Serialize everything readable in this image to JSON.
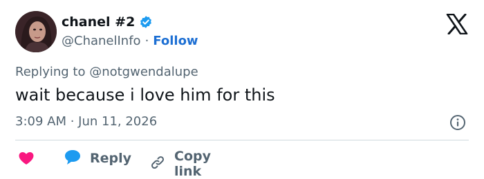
{
  "author": {
    "display_name": "chanel #2",
    "handle": "@ChanelInfo",
    "separator": "·",
    "follow_label": "Follow",
    "verified_color": "#1d9bf0"
  },
  "tweet": {
    "replying_to": "Replying to @notgwendalupe",
    "text": "wait because i love him for this",
    "timestamp": "3:09 AM · Jun 11, 2026"
  },
  "actions": {
    "reply_label": "Reply",
    "copy_link_label": "Copy link",
    "heart_color": "#f91880",
    "reply_icon_color": "#1d9bf0"
  },
  "icons": {
    "logo": "x-logo-icon",
    "info": "info-icon",
    "like": "heart-icon",
    "reply": "reply-bubble-icon",
    "copy": "link-icon"
  }
}
